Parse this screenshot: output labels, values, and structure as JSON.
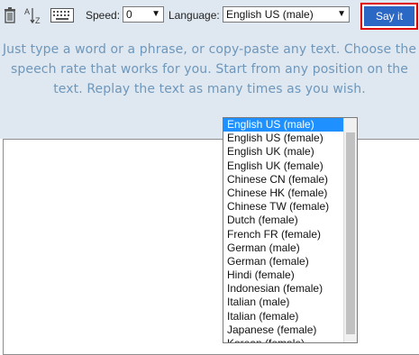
{
  "toolbar": {
    "icons": [
      "trash-icon",
      "sort-az-icon",
      "keyboard-icon"
    ],
    "speed_label": "Speed:",
    "speed_value": "0",
    "language_label": "Language:",
    "language_value": "English US (male)",
    "say_label": "Say it"
  },
  "intro": {
    "line1": "Just type a word or a phrase, or copy-paste any text. Choose the",
    "line2": "speech rate that works for you. Start from any position on the",
    "line3": "text. Replay the text as many times as you wish."
  },
  "textarea": {
    "value": ""
  },
  "dropdown": {
    "selected": "English US (male)",
    "options": [
      "English US (male)",
      "English US (female)",
      "English UK (male)",
      "English UK (female)",
      "Chinese CN (female)",
      "Chinese HK (female)",
      "Chinese TW (female)",
      "Dutch (female)",
      "French FR (female)",
      "German (male)",
      "German (female)",
      "Hindi (female)",
      "Indonesian (female)",
      "Italian (male)",
      "Italian (female)",
      "Japanese (female)",
      "Korean (female)"
    ]
  },
  "colors": {
    "toolbar_bg": "#dfe8f1",
    "intro_text": "#6e97bb",
    "say_button": "#2b67c4",
    "say_highlight": "#e00000",
    "selected_option": "#1e90ff"
  }
}
